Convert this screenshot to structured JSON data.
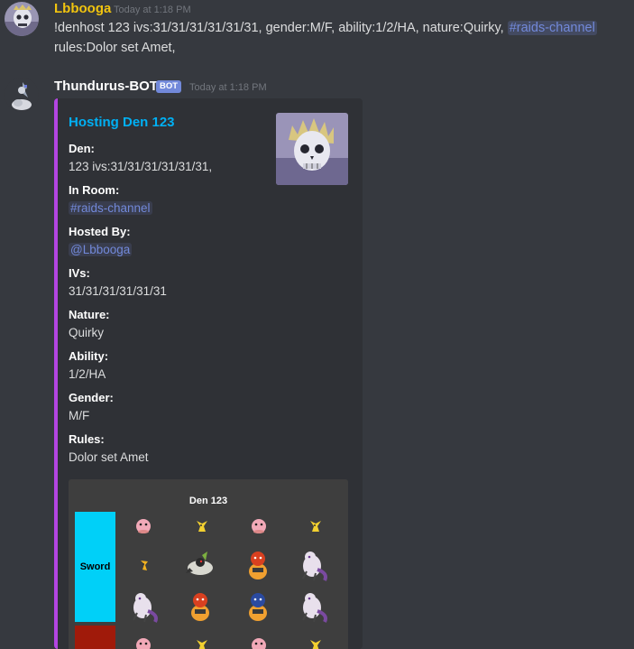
{
  "messages": [
    {
      "username": "Lbbooga",
      "username_color": "#f1c40f",
      "timestamp": "Today at 1:18 PM",
      "line1_text": "!denhost 123 ivs:31/31/31/31/31/31, gender:M/F, ability:1/2/HA, nature:Quirky, ",
      "line1_channel": "#raids-channel",
      "line2_text": "rules:Dolor set Amet,"
    },
    {
      "username": "Thundurus-BOT",
      "username_color": "#ffffff",
      "badge": "BOT",
      "timestamp": "Today at 1:18 PM"
    }
  ],
  "embed": {
    "accent_color": "#b445e2",
    "title": "Hosting Den 123",
    "fields": [
      {
        "name": "Den:",
        "value": "123 ivs:31/31/31/31/31/31,"
      },
      {
        "name": "In Room:",
        "value": "#raids-channel"
      },
      {
        "name": "Hosted By:",
        "value": "@Lbbooga"
      },
      {
        "name": "IVs:",
        "value": "31/31/31/31/31/31"
      },
      {
        "name": "Nature:",
        "value": "Quirky"
      },
      {
        "name": "Ability:",
        "value": "1/2/HA"
      },
      {
        "name": "Gender:",
        "value": "M/F"
      },
      {
        "name": "Rules:",
        "value": "Dolor set Amet"
      }
    ],
    "den_image": {
      "title": "Den 123",
      "games": [
        {
          "label": "Sword",
          "color": "#00d0f8"
        },
        {
          "label": "",
          "color": "#a01a0a"
        }
      ]
    }
  }
}
